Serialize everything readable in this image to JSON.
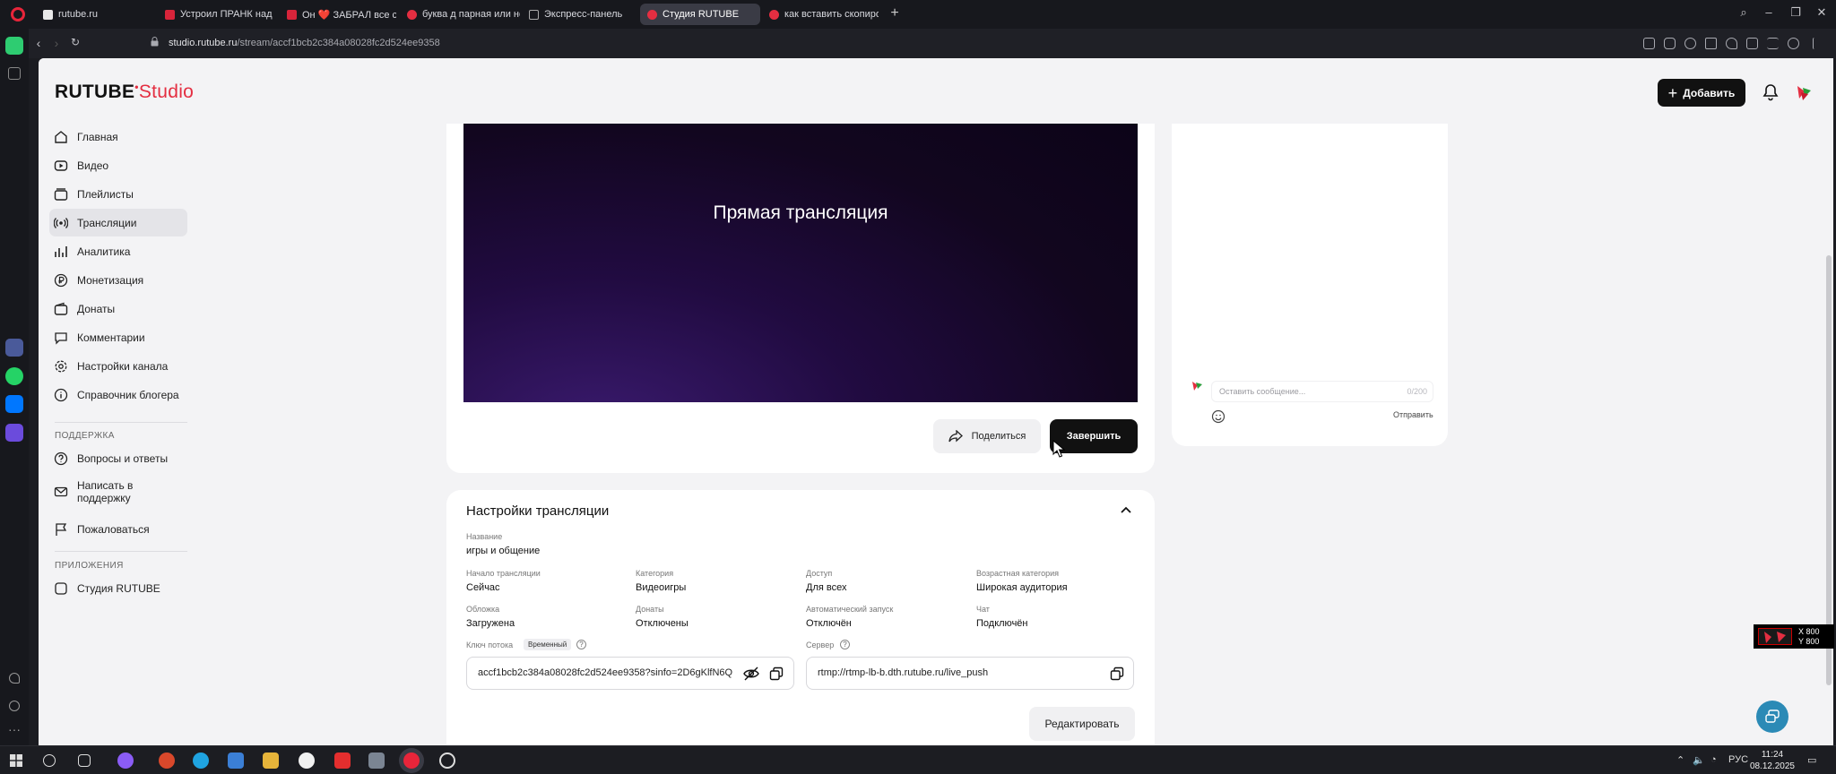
{
  "browser": {
    "tabs": [
      {
        "label": "rutube.ru",
        "active": false,
        "favicon_color": "#e8e8e8"
      },
      {
        "label": "Устроил ПРАНК над Учи",
        "active": false,
        "favicon_color": "#d7243a"
      },
      {
        "label": "Он ❤️ ЗАБРАЛ все сб",
        "active": false,
        "favicon_color": "#d7243a"
      },
      {
        "label": "буква д парная или нет -",
        "active": false,
        "favicon_color": "#e42e41"
      },
      {
        "label": "Экспресс-панель",
        "active": false,
        "favicon_color": "#8a8a90"
      },
      {
        "label": "Студия RUTUBE",
        "active": true,
        "favicon_color": "#e42e41"
      },
      {
        "label": "как вставить скопирова",
        "active": false,
        "favicon_color": "#e42e41"
      }
    ],
    "url_domain": "studio.rutube.ru",
    "url_path": "/stream/accf1bcb2c384a08028fc2d524ee9358"
  },
  "header": {
    "logo_main": "RUTUBE",
    "logo_studio": "Studio",
    "add_label": "Добавить"
  },
  "nav": {
    "items": [
      {
        "label": "Главная",
        "icon": "home-icon"
      },
      {
        "label": "Видео",
        "icon": "video-icon"
      },
      {
        "label": "Плейлисты",
        "icon": "playlist-icon"
      },
      {
        "label": "Трансляции",
        "icon": "broadcast-icon"
      },
      {
        "label": "Аналитика",
        "icon": "analytics-icon"
      },
      {
        "label": "Монетизация",
        "icon": "ruble-icon"
      },
      {
        "label": "Донаты",
        "icon": "wallet-icon"
      },
      {
        "label": "Комментарии",
        "icon": "comment-icon"
      },
      {
        "label": "Настройки канала",
        "icon": "gear-icon"
      },
      {
        "label": "Справочник блогера",
        "icon": "info-icon"
      }
    ],
    "support_title": "ПОДДЕРЖКА",
    "support_items": [
      {
        "label": "Вопросы и ответы",
        "icon": "question-icon"
      },
      {
        "label": "Написать в поддержку",
        "icon": "mail-icon"
      },
      {
        "label": "Пожаловаться",
        "icon": "flag-icon"
      }
    ],
    "apps_title": "ПРИЛОЖЕНИЯ",
    "apps_items": [
      {
        "label": "Студия RUTUBE",
        "icon": "studio-app-icon"
      }
    ]
  },
  "stream": {
    "player_title": "Прямая трансляция",
    "share_label": "Поделиться",
    "finish_label": "Завершить"
  },
  "chat": {
    "placeholder": "Оставить сообщение...",
    "counter": "0/200",
    "send_label": "Отправить"
  },
  "settings": {
    "title": "Настройки трансляции",
    "name_label": "Название",
    "name_value": "игры и общение",
    "fields": [
      {
        "label": "Начало трансляции",
        "value": "Сейчас"
      },
      {
        "label": "Категория",
        "value": "Видеоигры"
      },
      {
        "label": "Доступ",
        "value": "Для всех"
      },
      {
        "label": "Возрастная категория",
        "value": "Широкая аудитория"
      },
      {
        "label": "Обложка",
        "value": "Загружена"
      },
      {
        "label": "Донаты",
        "value": "Отключены"
      },
      {
        "label": "Автоматический запуск",
        "value": "Отключён"
      },
      {
        "label": "Чат",
        "value": "Подключён"
      }
    ],
    "stream_key_label": "Ключ потока",
    "stream_key_badge": "Временный",
    "stream_key_value": "accf1bcb2c384a08028fc2d524ee9358?sinfo=2D6gKlfN6Q",
    "server_label": "Сервер",
    "server_value": "rtmp://rtmp-lb-b.dth.rutube.ru/live_push",
    "edit_label": "Редактировать"
  },
  "overlay": {
    "x_text": "X 800",
    "y_text": "Y 800"
  },
  "taskbar": {
    "lang": "РУС",
    "time": "11:24",
    "date": "08.12.2025"
  },
  "colors": {
    "brand_red": "#e42e41",
    "dark_button": "#111111",
    "page_bg": "#f3f3f5",
    "player_purple": "#3a1a6e"
  }
}
